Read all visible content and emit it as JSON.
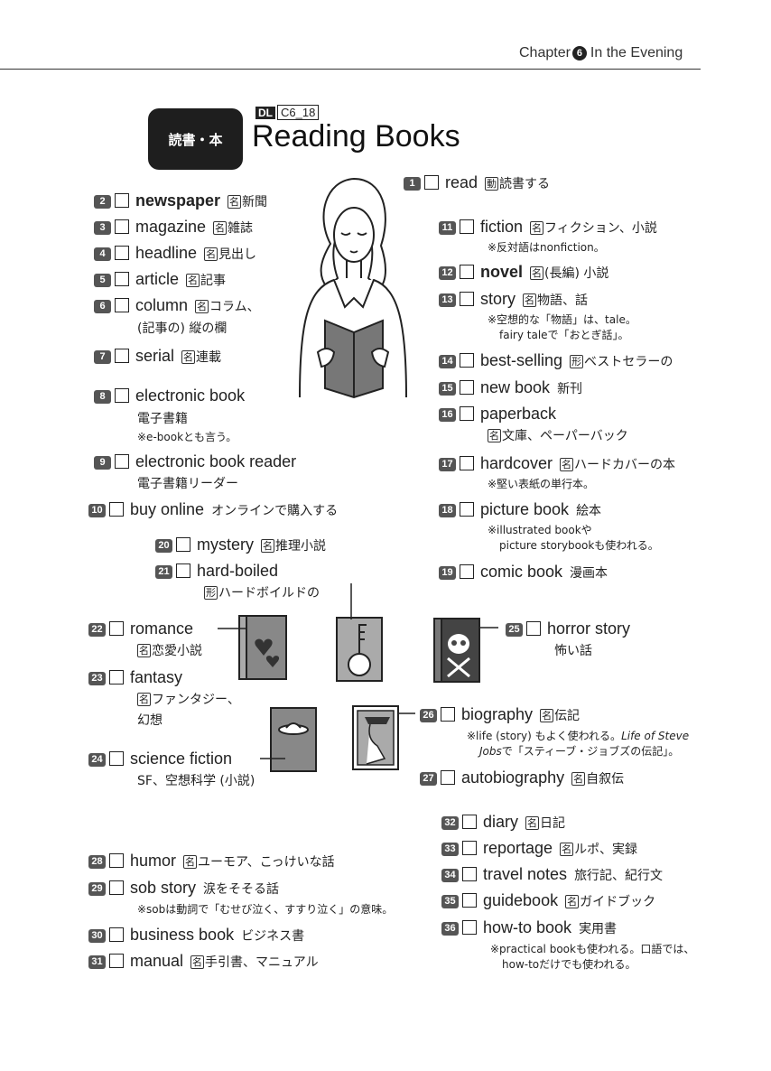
{
  "header": {
    "chapter_label": "Chapter",
    "chapter_number": "6",
    "chapter_title": "In the Evening"
  },
  "section": {
    "tag": "読書・本",
    "dl_box": "DL",
    "dl_code": "C6_18",
    "title": "Reading Books"
  },
  "entries": {
    "e1": {
      "num": "1",
      "word": "read",
      "pos": "動",
      "ja": "読書する"
    },
    "e2": {
      "num": "2",
      "word": "newspaper",
      "pos": "名",
      "ja": "新聞"
    },
    "e3": {
      "num": "3",
      "word": "magazine",
      "pos": "名",
      "ja": "雑誌"
    },
    "e4": {
      "num": "4",
      "word": "headline",
      "pos": "名",
      "ja": "見出し"
    },
    "e5": {
      "num": "5",
      "word": "article",
      "pos": "名",
      "ja": "記事"
    },
    "e6": {
      "num": "6",
      "word": "column",
      "pos": "名",
      "ja": "コラム、",
      "ja2": "(記事の) 縦の欄"
    },
    "e7": {
      "num": "7",
      "word": "serial",
      "pos": "名",
      "ja": "連載"
    },
    "e8": {
      "num": "8",
      "word": "electronic book",
      "ja": "電子書籍",
      "note": "※e-bookとも言う。"
    },
    "e9": {
      "num": "9",
      "word": "electronic book reader",
      "ja": "電子書籍リーダー"
    },
    "e10": {
      "num": "10",
      "word": "buy online",
      "ja": "オンラインで購入する"
    },
    "e11": {
      "num": "11",
      "word": "fiction",
      "pos": "名",
      "ja": "フィクション、小説",
      "note": "※反対語はnonfiction。"
    },
    "e12": {
      "num": "12",
      "word": "novel",
      "pos": "名",
      "ja": "(長編) 小説"
    },
    "e13": {
      "num": "13",
      "word": "story",
      "pos": "名",
      "ja": "物語、話",
      "note1": "※空想的な「物語」は、tale。",
      "note2": "fairy taleで「おとぎ話」。"
    },
    "e14": {
      "num": "14",
      "word": "best-selling",
      "pos": "形",
      "ja": "ベストセラーの"
    },
    "e15": {
      "num": "15",
      "word": "new book",
      "ja": "新刊"
    },
    "e16": {
      "num": "16",
      "word": "paperback",
      "pos": "名",
      "ja": "文庫、ペーパーバック"
    },
    "e17": {
      "num": "17",
      "word": "hardcover",
      "pos": "名",
      "ja": "ハードカバーの本",
      "note": "※堅い表紙の単行本。"
    },
    "e18": {
      "num": "18",
      "word": "picture book",
      "ja": "絵本",
      "note1": "※illustrated bookや",
      "note2": "picture storybookも使われる。"
    },
    "e19": {
      "num": "19",
      "word": "comic book",
      "ja": "漫画本"
    },
    "e20": {
      "num": "20",
      "word": "mystery",
      "pos": "名",
      "ja": "推理小説"
    },
    "e21": {
      "num": "21",
      "word": "hard-boiled",
      "pos": "形",
      "ja": "ハードボイルドの"
    },
    "e22": {
      "num": "22",
      "word": "romance",
      "pos": "名",
      "ja": "恋愛小説"
    },
    "e23": {
      "num": "23",
      "word": "fantasy",
      "pos": "名",
      "ja": "ファンタジー、",
      "ja2": "幻想"
    },
    "e24": {
      "num": "24",
      "word": "science fiction",
      "ja": "SF、空想科学 (小説)"
    },
    "e25": {
      "num": "25",
      "word": "horror story",
      "ja": "怖い話"
    },
    "e26": {
      "num": "26",
      "word": "biography",
      "pos": "名",
      "ja": "伝記",
      "note1a": "※life (story) もよく使われる。",
      "note1b": "Life of Steve",
      "note2a": "Jobs",
      "note2b": "で「スティーブ・ジョブズの伝記」。"
    },
    "e27": {
      "num": "27",
      "word": "autobiography",
      "pos": "名",
      "ja": "自叙伝"
    },
    "e28": {
      "num": "28",
      "word": "humor",
      "pos": "名",
      "ja": "ユーモア、こっけいな話"
    },
    "e29": {
      "num": "29",
      "word": "sob story",
      "ja": "涙をそそる話",
      "note": "※sobは動詞で「むせび泣く、すすり泣く」の意味。"
    },
    "e30": {
      "num": "30",
      "word": "business book",
      "ja": "ビジネス書"
    },
    "e31": {
      "num": "31",
      "word": "manual",
      "pos": "名",
      "ja": "手引書、マニュアル"
    },
    "e32": {
      "num": "32",
      "word": "diary",
      "pos": "名",
      "ja": "日記"
    },
    "e33": {
      "num": "33",
      "word": "reportage",
      "pos": "名",
      "ja": "ルポ、実録"
    },
    "e34": {
      "num": "34",
      "word": "travel notes",
      "ja": "旅行記、紀行文"
    },
    "e35": {
      "num": "35",
      "word": "guidebook",
      "pos": "名",
      "ja": "ガイドブック"
    },
    "e36": {
      "num": "36",
      "word": "how-to book",
      "ja": "実用書",
      "note1": "※practical bookも使われる。口語では、",
      "note2": "how-toだけでも使われる。"
    }
  }
}
